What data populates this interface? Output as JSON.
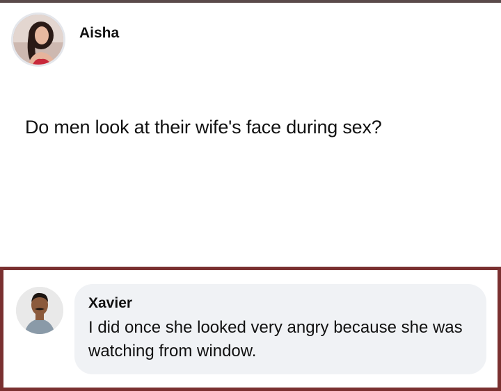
{
  "post": {
    "author_name": "Aisha",
    "text": "Do men look at their wife's face during sex?"
  },
  "comment": {
    "author_name": "Xavier",
    "text": "I did once she looked very angry because she was watching from window."
  }
}
